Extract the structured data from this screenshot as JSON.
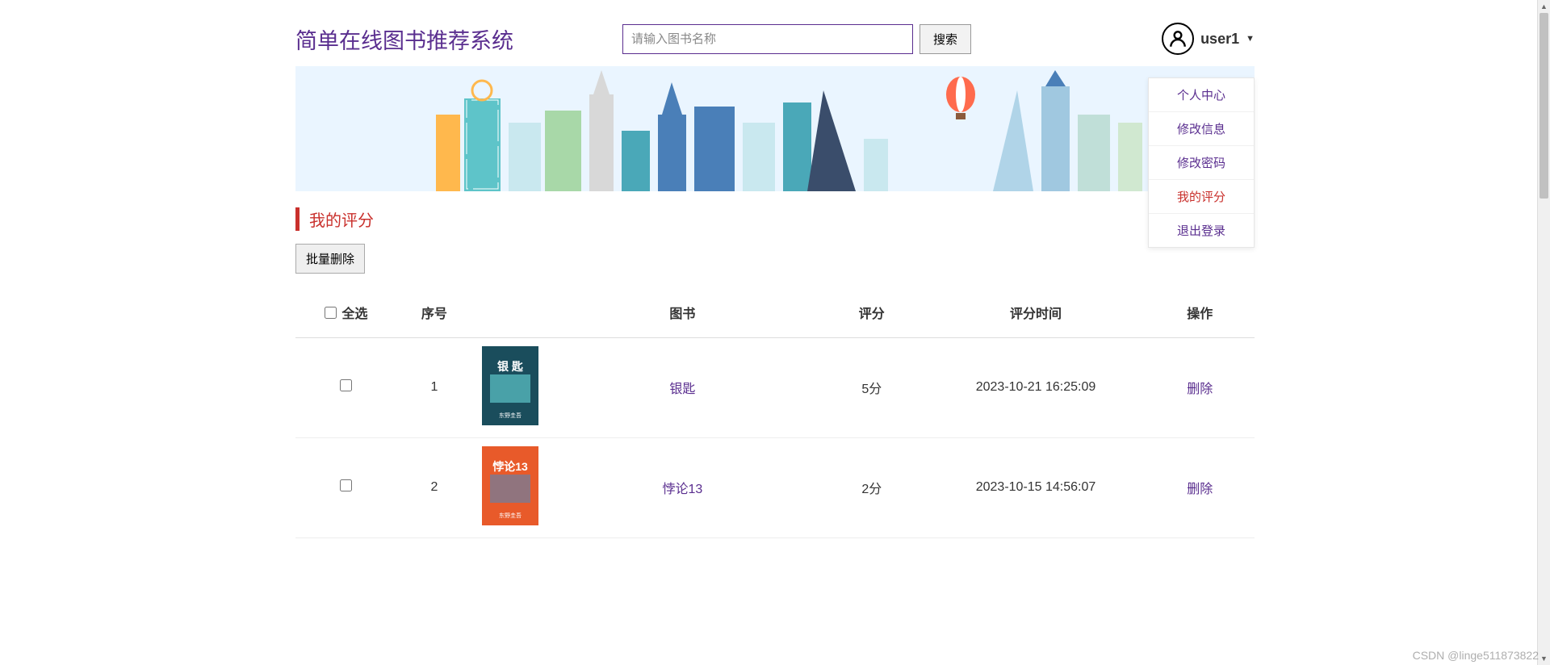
{
  "header": {
    "title": "简单在线图书推荐系统",
    "search_placeholder": "请输入图书名称",
    "search_button": "搜索",
    "user_name": "user1"
  },
  "dropdown": {
    "items": [
      {
        "label": "个人中心",
        "active": false
      },
      {
        "label": "修改信息",
        "active": false
      },
      {
        "label": "修改密码",
        "active": false
      },
      {
        "label": "我的评分",
        "active": true
      },
      {
        "label": "退出登录",
        "active": false
      }
    ]
  },
  "section": {
    "title": "我的评分",
    "batch_delete": "批量删除"
  },
  "table": {
    "headers": {
      "select_all": "全选",
      "seq": "序号",
      "book": "图书",
      "rating": "评分",
      "time": "评分时间",
      "op": "操作"
    },
    "rows": [
      {
        "seq": "1",
        "title": "银匙",
        "rating": "5分",
        "time": "2023-10-21 16:25:09",
        "op": "删除",
        "cover_bg": "#1a4d5c",
        "cover_accent": "#5ec4c9",
        "cover_text": "银 匙"
      },
      {
        "seq": "2",
        "title": "悖论13",
        "rating": "2分",
        "time": "2023-10-15 14:56:07",
        "op": "删除",
        "cover_bg": "#e85a2a",
        "cover_accent": "#6b7fa3",
        "cover_text": "悖论13"
      }
    ]
  },
  "watermark": "CSDN @linge511873822"
}
